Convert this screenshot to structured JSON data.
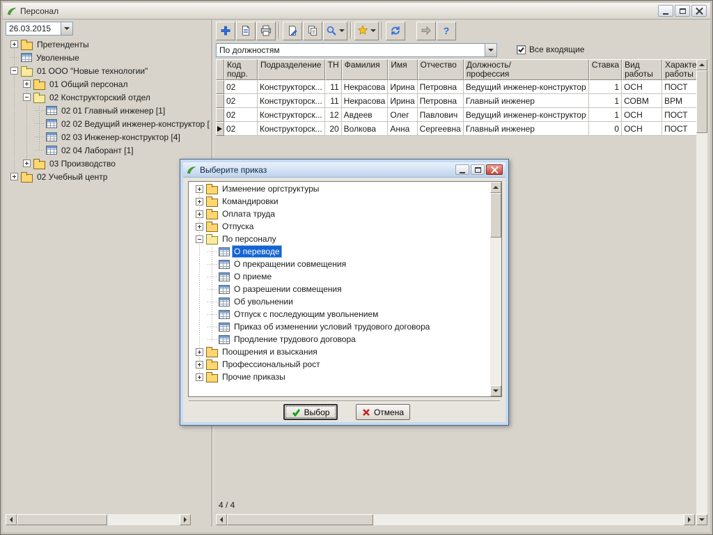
{
  "window": {
    "title": "Персонал"
  },
  "date_picker": {
    "value": "26.03.2015"
  },
  "left_tree": {
    "items": [
      {
        "label": "Претенденты"
      },
      {
        "label": "Уволенные"
      },
      {
        "label": "01 ООО \"Новые технологии\""
      },
      {
        "label": "01 Общий персонал"
      },
      {
        "label": "02 Конструкторский отдел"
      },
      {
        "label": "02 01 Главный инженер [1]"
      },
      {
        "label": "02 02 Ведущий инженер-конструктор ["
      },
      {
        "label": "02 03 Инженер-конструктор [4]"
      },
      {
        "label": "02 04 Лаборант [1]"
      },
      {
        "label": "03 Производство"
      },
      {
        "label": "02 Учебный центр"
      }
    ]
  },
  "toolbar": {
    "buttons": [
      "add",
      "card",
      "print",
      "export",
      "copy",
      "search",
      "orders",
      "refresh",
      "forward",
      "help"
    ]
  },
  "filter": {
    "combo_value": "По должностям",
    "checkbox_label": "Все входящие",
    "checkbox_checked": true
  },
  "grid": {
    "columns": [
      "Код\nподр.",
      "Подразделение",
      "ТН",
      "Фамилия",
      "Имя",
      "Отчество",
      "Должность/\nпрофессия",
      "Ставка",
      "Вид\nработы",
      "Характер\nработы"
    ],
    "rows": [
      [
        "02",
        "Конструкторск...",
        "11",
        "Некрасова",
        "Ирина",
        "Петровна",
        "Ведущий инженер-конструктор",
        "1",
        "ОСН",
        "ПОСТ"
      ],
      [
        "02",
        "Конструкторск...",
        "11",
        "Некрасова",
        "Ирина",
        "Петровна",
        "Главный инженер",
        "1",
        "СОВМ",
        "ВРМ"
      ],
      [
        "02",
        "Конструкторск...",
        "12",
        "Авдеев",
        "Олег",
        "Павлович",
        "Ведущий инженер-конструктор",
        "1",
        "ОСН",
        "ПОСТ"
      ],
      [
        "02",
        "Конструкторск...",
        "20",
        "Волкова",
        "Анна",
        "Сергеевна",
        "Главный инженер",
        "0",
        "ОСН",
        "ПОСТ"
      ]
    ],
    "current_row_index": 3,
    "status": "4 / 4"
  },
  "dialog": {
    "title": "Выберите приказ",
    "items": [
      {
        "label": "Изменение оргструктуры"
      },
      {
        "label": "Командировки"
      },
      {
        "label": "Оплата труда"
      },
      {
        "label": "Отпуска"
      },
      {
        "label": "По персоналу"
      },
      {
        "label": "О переводе"
      },
      {
        "label": "О прекращении совмещения"
      },
      {
        "label": "О приеме"
      },
      {
        "label": "О разрешении совмещения"
      },
      {
        "label": "Об увольнении"
      },
      {
        "label": "Отпуск с последующим увольнением"
      },
      {
        "label": "Приказ об изменении условий трудового договора"
      },
      {
        "label": "Продление трудового договора"
      },
      {
        "label": "Поощрения и взыскания"
      },
      {
        "label": "Профессиональный рост"
      },
      {
        "label": "Прочие приказы"
      }
    ],
    "buttons": {
      "select": "Выбор",
      "cancel": "Отмена"
    }
  }
}
